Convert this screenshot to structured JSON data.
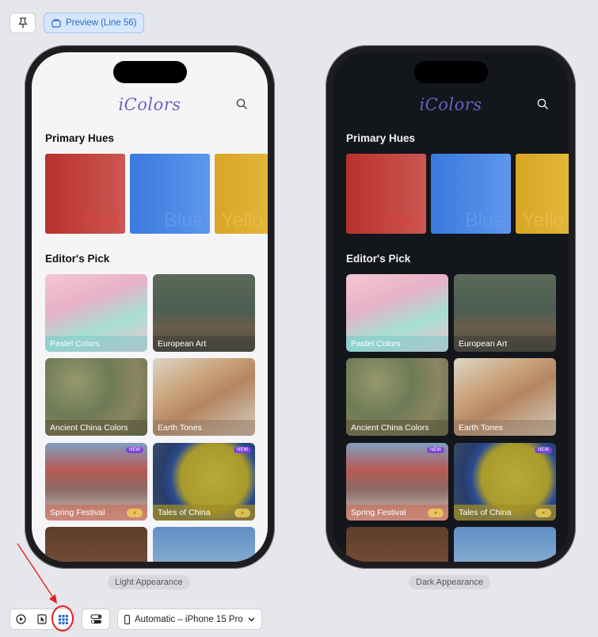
{
  "toolbar": {
    "pin_icon": "pin-icon",
    "preview_label": "Preview (Line 56)"
  },
  "app": {
    "title": "iColors",
    "primary_hues_title": "Primary Hues",
    "editors_pick_title": "Editor's Pick",
    "hues": [
      "Red",
      "Blue",
      "Yello"
    ],
    "cards": [
      "Pastel Colors",
      "European Art",
      "Ancient China Colors",
      "Earth Tones",
      "Spring Festival",
      "Tales of China"
    ],
    "new_badge": "NEW"
  },
  "captions": {
    "light": "Light Appearance",
    "dark": "Dark Appearance"
  },
  "bottom_toolbar": {
    "device_label": "Automatic – iPhone 15 Pro"
  },
  "colors": {
    "accent": "#2a6bc9",
    "annotation": "#e02020",
    "title_purple": "#6b5fc7"
  }
}
